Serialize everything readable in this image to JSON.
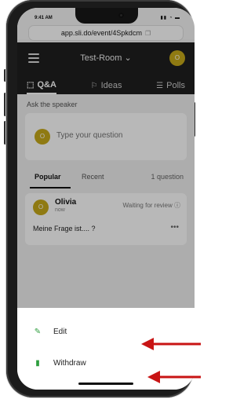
{
  "status_bar": {
    "time": "9:41 AM",
    "icons": "▮▮ ◔ ▬"
  },
  "url_bar": {
    "url": "app.sli.do/event/4Spkdcm",
    "copy_icon": "❐"
  },
  "header": {
    "title": "Test-Room",
    "chevron": "⌄",
    "avatar_letter": "O",
    "menu_icon": "hamburger-icon"
  },
  "tabs": [
    {
      "icon": "⬚",
      "label": "Q&A",
      "active": true
    },
    {
      "icon": "⚐",
      "label": "Ideas",
      "active": false
    },
    {
      "icon": "☰",
      "label": "Polls",
      "active": false
    }
  ],
  "ask": {
    "label": "Ask the speaker",
    "placeholder": "Type your question",
    "avatar_letter": "O"
  },
  "filters": {
    "popular": "Popular",
    "recent": "Recent",
    "count": "1 question"
  },
  "question": {
    "author": "Olivia",
    "time": "now",
    "status": "Waiting for review ⓘ",
    "text": "Meine Frage ist.... ?",
    "more": "•••",
    "avatar_letter": "O"
  },
  "sheet": {
    "items": [
      {
        "icon": "✎",
        "label": "Edit"
      },
      {
        "icon": "▮",
        "label": "Withdraw"
      }
    ]
  },
  "colors": {
    "accent_avatar": "#c7a91a",
    "header_bg": "#1f1f1f",
    "action_green": "#2e9e3e",
    "arrow_red": "#c81414"
  }
}
